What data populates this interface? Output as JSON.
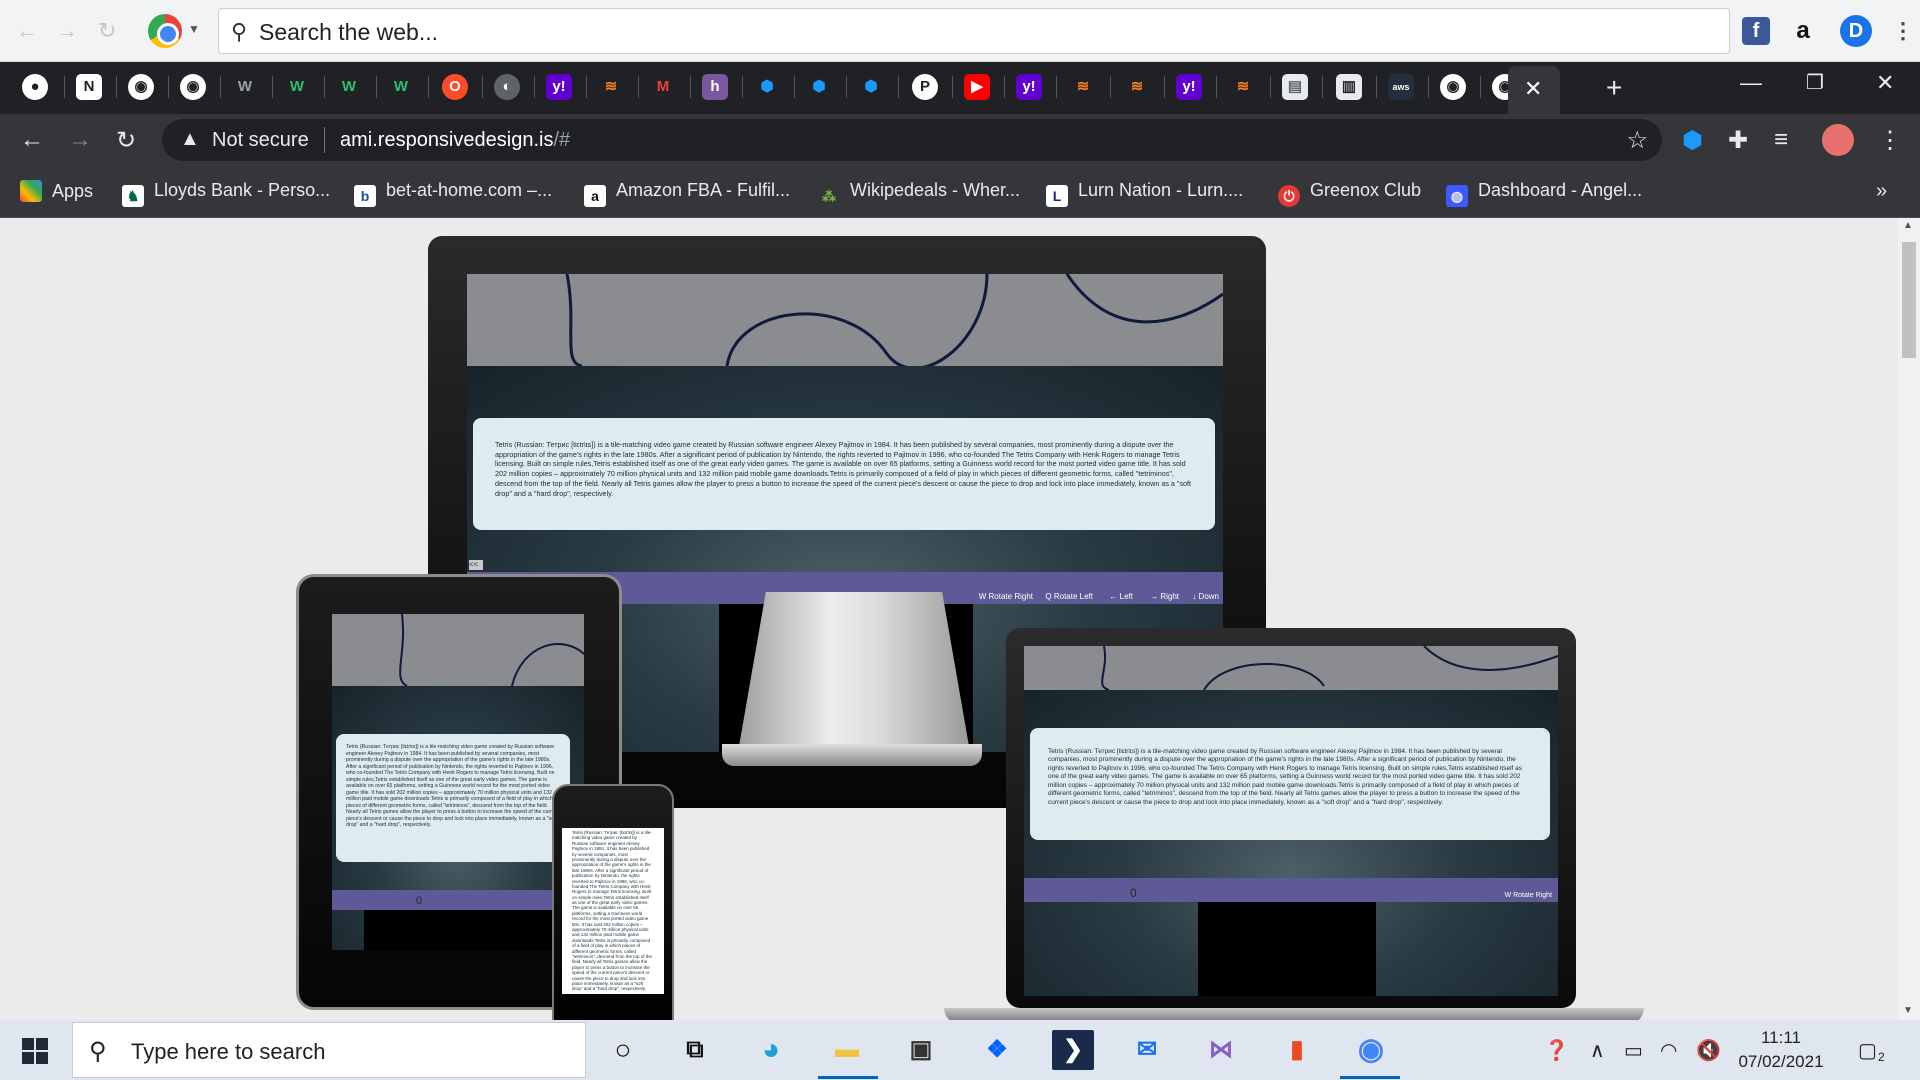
{
  "top_search": {
    "placeholder": "Search the web..."
  },
  "top_right_icons": [
    "facebook-icon",
    "amazon-icon",
    "profile-d-icon",
    "more-icon"
  ],
  "tabs": {
    "favicons": [
      "pushbullet",
      "notion",
      "github",
      "github",
      "w",
      "w-green",
      "w-green",
      "w-green",
      "opera",
      "globe",
      "yahoo",
      "stackoverflow",
      "gmail",
      "heroku",
      "cube",
      "cube",
      "cube",
      "pocket",
      "youtube",
      "yahoo",
      "stackoverflow",
      "stackoverflow",
      "yahoo",
      "stackoverflow",
      "doc",
      "reader",
      "aws",
      "github",
      "github"
    ],
    "new_tab": "+"
  },
  "toolbar": {
    "security_label": "Not secure",
    "url_host": "ami.responsivedesign.is",
    "url_path": "/#"
  },
  "bookmarks": [
    {
      "label": "Apps"
    },
    {
      "label": "Lloyds Bank - Perso..."
    },
    {
      "label": "bet-at-home.com –..."
    },
    {
      "label": "Amazon FBA - Fulfil..."
    },
    {
      "label": "Wikipedeals - Wher..."
    },
    {
      "label": "Lurn Nation - Lurn...."
    },
    {
      "label": "Greenox Club"
    },
    {
      "label": "Dashboard - Angel..."
    }
  ],
  "bookmarks_overflow": "»",
  "site": {
    "description": "Tetris (Russian: Тетрис [tʲɛtrʲɪs]) is a tile-matching video game created by Russian software engineer Alexey Pajitnov in 1984. It has been published by several companies, most prominently during a dispute over the appropriation of the game's rights in the late 1980s. After a significant period of publication by Nintendo, the rights reverted to Pajitnov in 1996, who co-founded The Tetris Company with Henk Rogers to manage Tetris licensing. Built on simple rules,Tetris established itself as one of the great early video games. The game is available on over 65 platforms, setting a Guinness world record for the most ported video game title. It has sold 202 million copies – approximately 70 million physical units and 132 million paid mobile game downloads.Tetris is primarily composed of a field of play in which pieces of different geometric forms, called \"tetriminos\", descend from the top of the field. Nearly all Tetris games allow the player to press a button to increase the speed of the current piece's descent or cause the piece to drop and lock into place immediately, known as a \"soft drop\" and a \"hard drop\", respectively.",
    "score": "0",
    "controls": [
      "W Rotate Right",
      "Q Rotate Left",
      "← Left",
      "→ Right",
      "↓ Down"
    ],
    "collapse_label": "<<"
  },
  "taskbar": {
    "search_placeholder": "Type here to search",
    "apps": [
      "cortana-icon",
      "task-view-icon",
      "edge-icon",
      "file-explorer-icon",
      "store-icon",
      "dropbox-icon",
      "powershell-icon",
      "mail-icon",
      "visual-studio-icon",
      "office-icon",
      "chrome-icon"
    ],
    "time": "11:11",
    "date": "07/02/2021",
    "notification_count": "2"
  },
  "colors": {
    "chrome_dark": "#202124",
    "toolbar": "#35363a",
    "control_bar": "#5d5a97",
    "card": "#dfecef",
    "viewport_bg": "#ebebeb",
    "taskbar": "#dfe6ef"
  }
}
